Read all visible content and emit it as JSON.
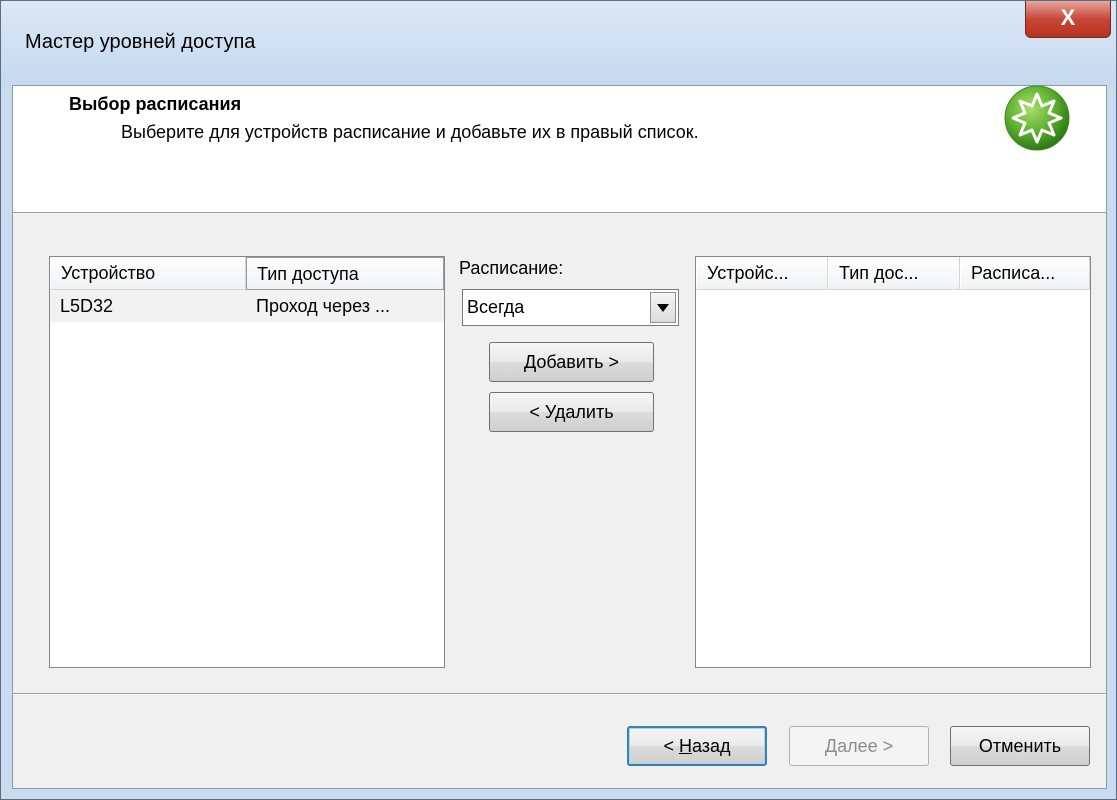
{
  "window": {
    "title": "Мастер уровней доступа",
    "close_label": "X"
  },
  "header": {
    "title": "Выбор расписания",
    "subtitle": "Выберите для устройств расписание и добавьте их в правый список.",
    "icon": "wizard-starburst-icon",
    "icon_color": "#5aae2e"
  },
  "left_list": {
    "columns": [
      "Устройство",
      "Тип доступа"
    ],
    "rows": [
      [
        "L5D32",
        "Проход через ..."
      ]
    ]
  },
  "schedule": {
    "label": "Расписание:",
    "selected": "Всегда",
    "add_label": "Добавить >",
    "remove_label": "< Удалить"
  },
  "right_list": {
    "columns": [
      "Устройс...",
      "Тип дос...",
      "Расписа..."
    ],
    "rows": []
  },
  "footer": {
    "back_prefix": "< ",
    "back_underlined": "Н",
    "back_rest": "азад",
    "next_underlined": "Д",
    "next_rest": "алее >",
    "cancel_label": "Отменить"
  }
}
